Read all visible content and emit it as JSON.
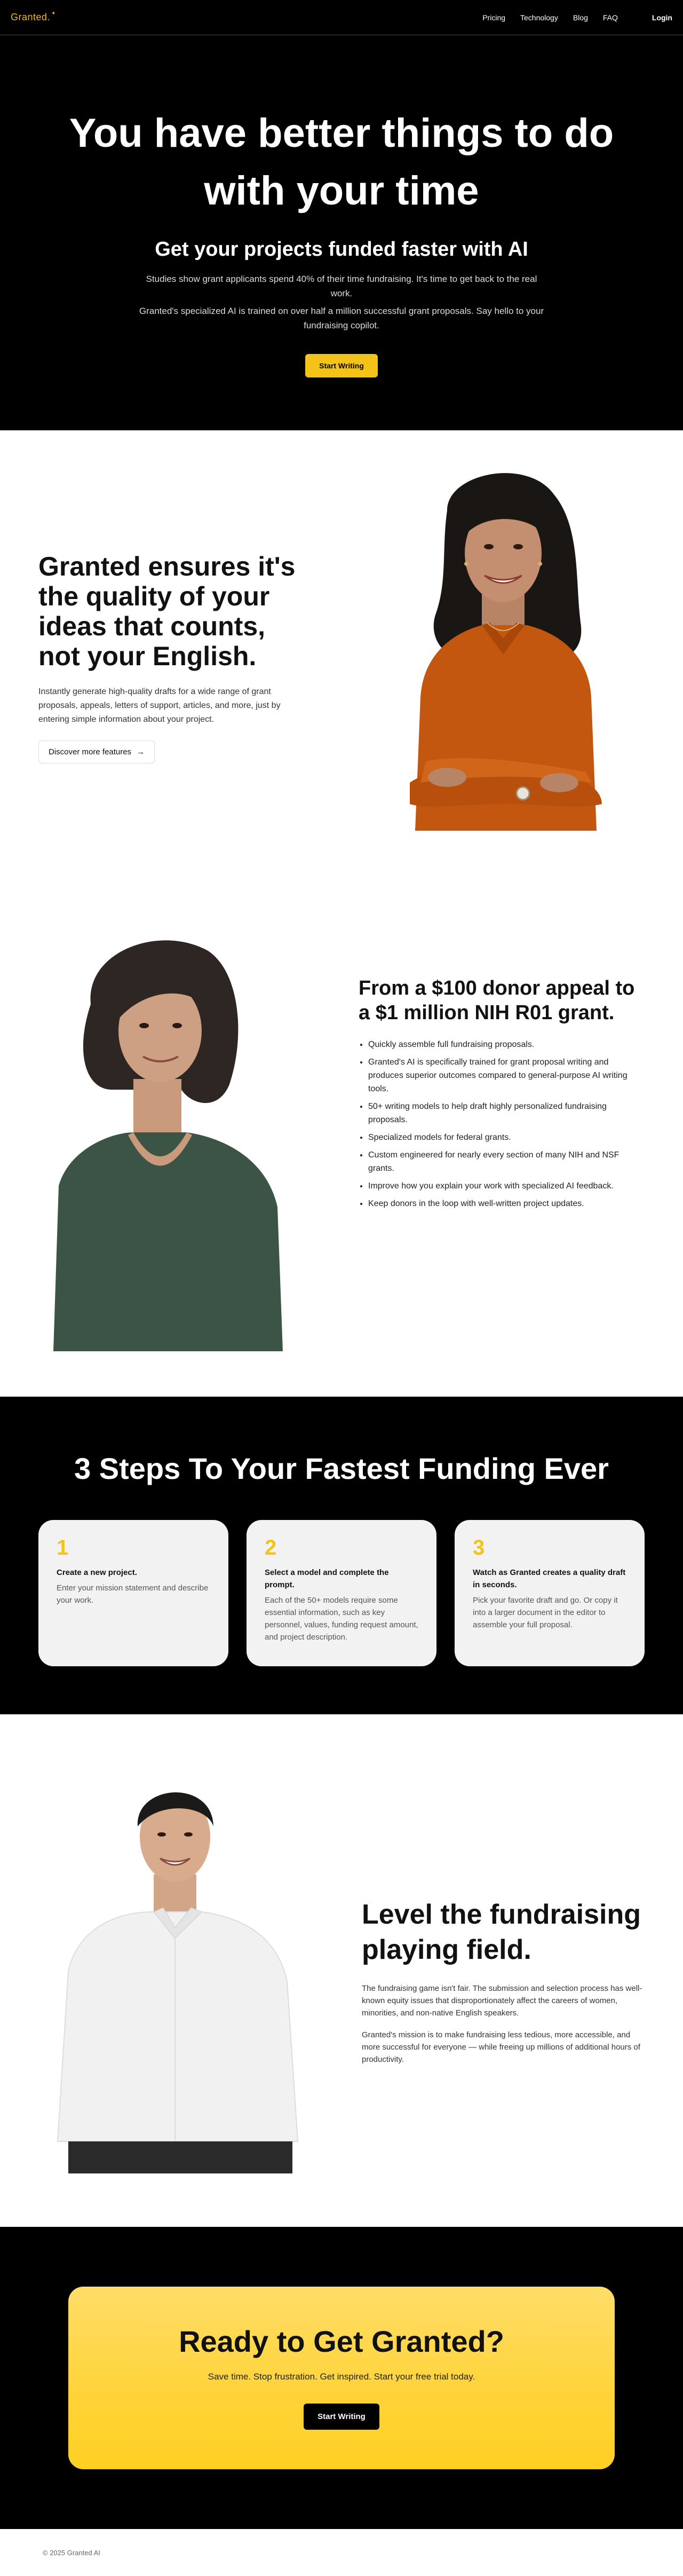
{
  "nav": {
    "logo": "Granted.",
    "links": [
      "Pricing",
      "Technology",
      "Blog",
      "FAQ"
    ],
    "login": "Login"
  },
  "hero": {
    "title": "You have better things to do with your time",
    "subtitle": "Get your projects funded faster with AI",
    "p1": "Studies show grant applicants spend 40% of their time fundraising. It's time to get back to the real work.",
    "p2": "Granted's specialized AI is trained on over half a million successful grant proposals. Say hello to your fundraising copilot.",
    "cta": "Start Writing"
  },
  "quality": {
    "title": "Granted ensures it's the quality of your ideas that counts, not your English.",
    "body": "Instantly generate high-quality drafts for a wide range of grant proposals, appeals, letters of support, articles, and more, just by entering simple information about your project.",
    "button": "Discover more features",
    "arrow": "→"
  },
  "features": {
    "title": "From a $100 donor appeal to a $1 million NIH R01 grant.",
    "items": [
      "Quickly assemble full fundraising proposals.",
      "Granted's AI is specifically trained for grant proposal writing and produces superior outcomes compared to general-purpose AI writing tools.",
      "50+ writing models to help draft highly personalized fundraising proposals.",
      "Specialized models for federal grants.",
      "Custom engineered for nearly every section of many NIH and NSF grants.",
      "Improve how you explain your work with specialized AI feedback.",
      "Keep donors in the loop with well-written project updates."
    ]
  },
  "steps": {
    "title": "3 Steps To Your Fastest Funding Ever",
    "items": [
      {
        "num": "1",
        "title": "Create a new project.",
        "desc": "Enter your mission statement and describe your work."
      },
      {
        "num": "2",
        "title": "Select a model and complete the prompt.",
        "desc": "Each of the 50+ models require some essential information, such as key personnel, values, funding request amount, and project description."
      },
      {
        "num": "3",
        "title": "Watch as Granted creates a quality draft in seconds.",
        "desc": "Pick your favorite draft and go. Or copy it into a larger document in the editor to assemble your full proposal."
      }
    ]
  },
  "level": {
    "title": "Level the fundraising playing field.",
    "p1": "The fundraising game isn't fair. The submission and selection process has well-known equity issues that disproportionately affect the careers of women, minorities, and non-native English speakers.",
    "p2": "Granted's mission is to make fundraising less tedious, more accessible, and more successful for everyone — while freeing up millions of additional hours of productivity."
  },
  "cta": {
    "title": "Ready to Get Granted?",
    "body": "Save time. Stop frustration. Get inspired. Start your free trial today.",
    "button": "Start Writing"
  },
  "footer": {
    "copyright": "© 2025 Granted AI"
  },
  "colors": {
    "accent": "#f3c319",
    "logo": "#f3b51a",
    "dark": "#000000"
  }
}
